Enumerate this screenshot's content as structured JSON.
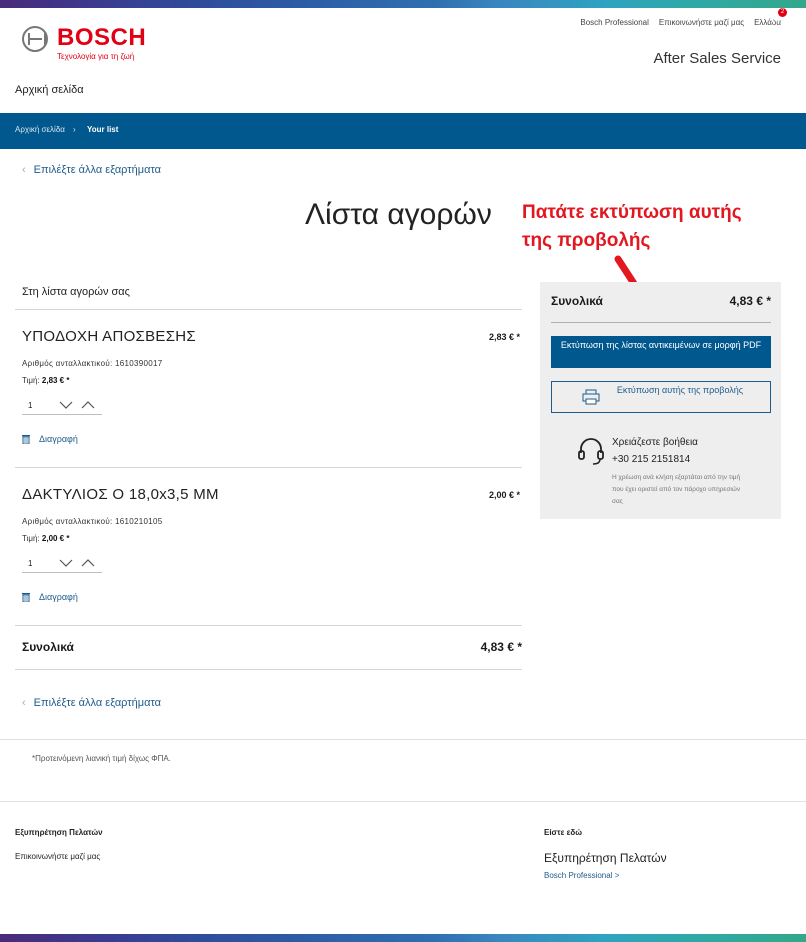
{
  "header": {
    "brand": "BOSCH",
    "tagline": "Τεχνολογία για τη ζωή",
    "top_links": [
      "Bosch Professional",
      "Επικοινωνήστε μαζί μας",
      "Ελλάδα"
    ],
    "service_title": "After Sales Service",
    "home_link": "Αρχική σελίδα"
  },
  "nav": {
    "breadcrumb_home": "Αρχική σελίδα",
    "breadcrumb_separator": "›",
    "breadcrumb_current": "Your list",
    "cart_count": "2"
  },
  "main": {
    "back_link": "Επιλέξτε άλλα εξαρτήματα",
    "title": "Λίστα αγορών",
    "subheading": "Στη λίστα αγορών σας",
    "items": [
      {
        "name": "ΥΠΟΔΟΧΗ ΑΠΟΣΒΕΣΗΣ",
        "price": "2,83 € *",
        "part_label": "Αριθμός ανταλλακτικού: 1610390017",
        "unit_price_label": "Τιμή:",
        "unit_price": "2,83 € *",
        "quantity": "1",
        "delete_label": "Διαγραφή"
      },
      {
        "name": "ΔΑΚΤΥΛΙΟΣ Ο 18,0x3,5 MM",
        "price": "2,00 € *",
        "part_label": "Αριθμός ανταλλακτικού: 1610210105",
        "unit_price_label": "Τιμή:",
        "unit_price": "2,00 € *",
        "quantity": "1",
        "delete_label": "Διαγραφή"
      }
    ],
    "total_label": "Συνολικά",
    "total_value": "4,83 € *",
    "footnote": "*Προτεινόμενη λιανική τιμή δίχως ΦΠΑ."
  },
  "annotation": {
    "text": "Πατάτε εκτύπωση αυτής της προβολής",
    "color": "#e3171f"
  },
  "panel": {
    "total_label": "Συνολικά",
    "total_value": "4,83 € *",
    "pdf_button": "Εκτύπωση της λίστας αντικειμένων σε μορφή PDF",
    "print_button": "Εκτύπωση αυτής της προβολής",
    "help_title": "Χρειάζεστε βοήθεια",
    "help_phone": "+30 215 2151814",
    "help_note": "Η χρέωση ανά κλήση εξαρτάται από την τιμή που έχει οριστεί από τον πάροχο υπηρεσιών σας"
  },
  "footer": {
    "left_heading": "Εξυπηρέτηση Πελατών",
    "contact_link": "Επικοινωνήστε μαζί μας",
    "right_heading": "Είστε εδώ",
    "service_label": "Εξυπηρέτηση Πελατών",
    "pro_link": "Bosch Professional >"
  },
  "colors": {
    "brand_red": "#e20015",
    "nav_blue": "#00588f",
    "link_blue": "#1f5c8c",
    "panel_gray": "#eeeeee"
  },
  "icons": [
    "cart-icon",
    "chevron-left-icon",
    "chevron-down-icon",
    "chevron-up-icon",
    "trash-icon",
    "printer-icon",
    "headset-icon",
    "arrow-icon"
  ]
}
